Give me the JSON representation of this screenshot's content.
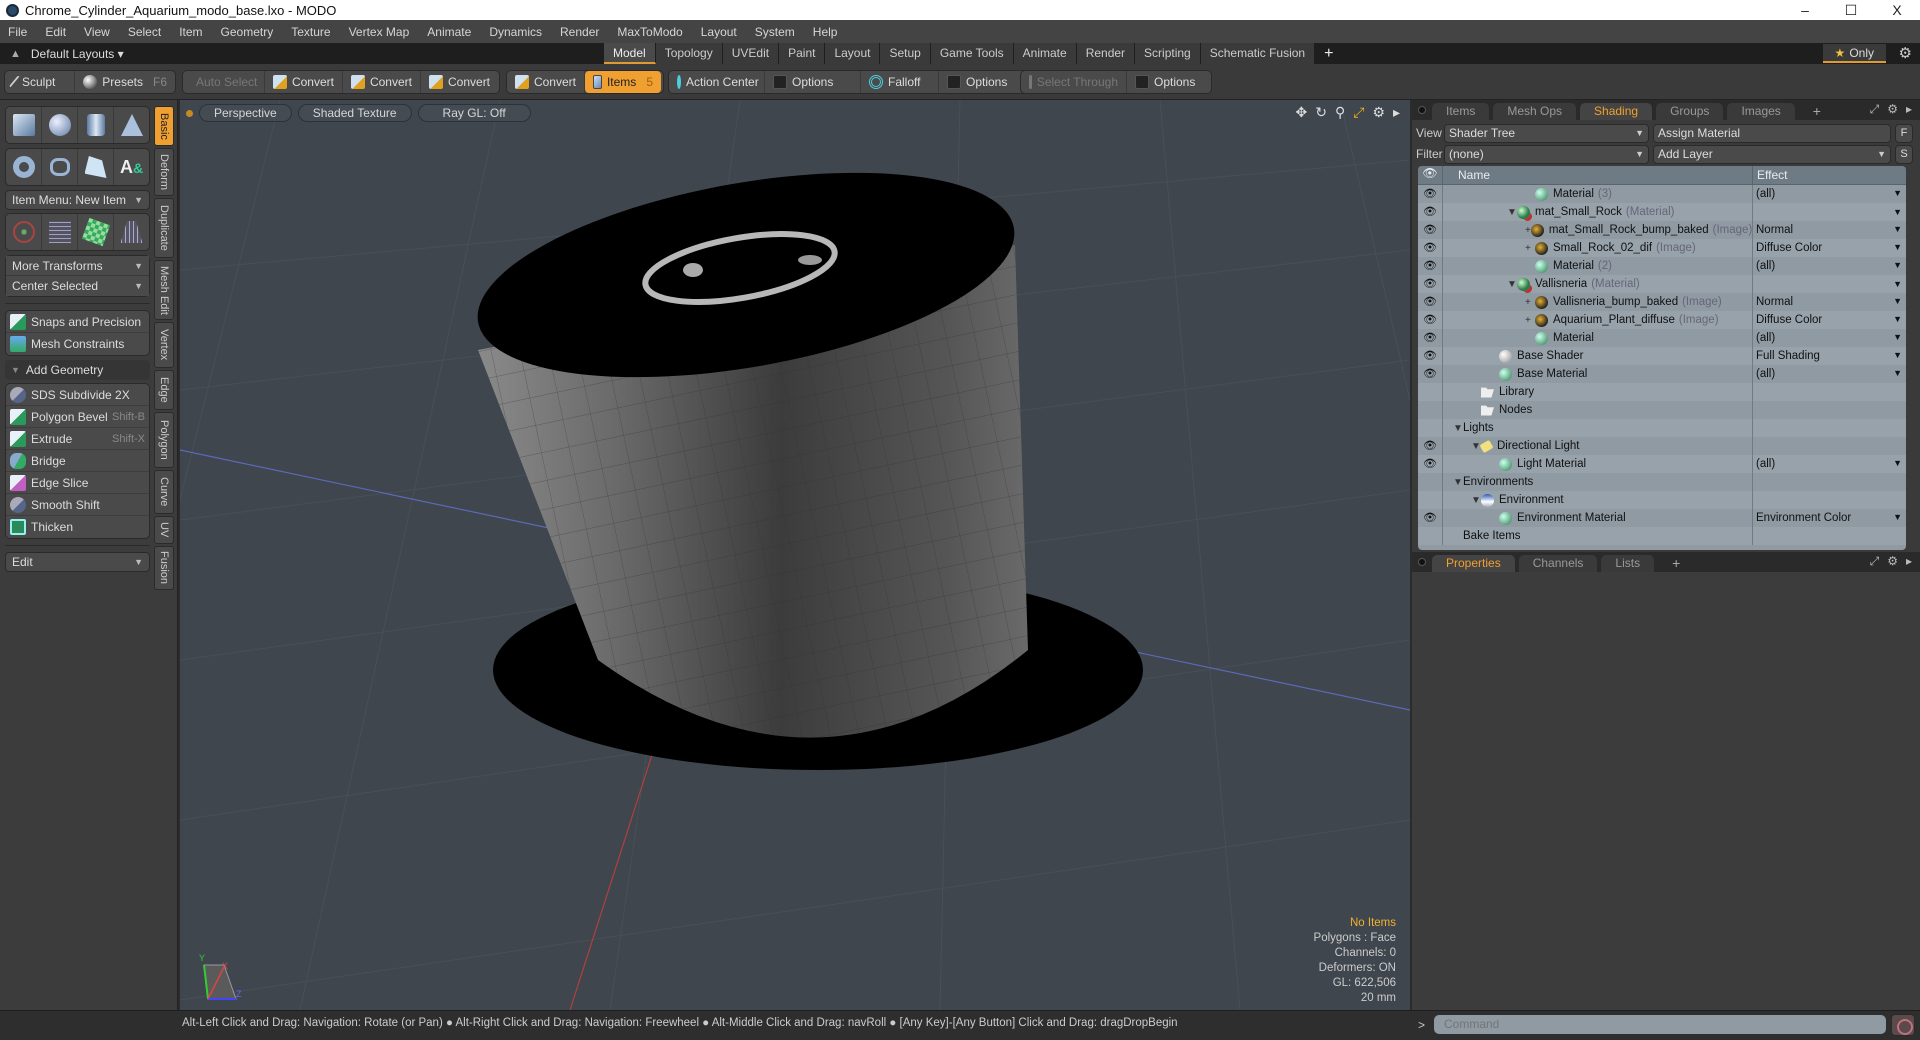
{
  "window": {
    "title": "Chrome_Cylinder_Aquarium_modo_base.lxo - MODO",
    "controls": [
      "–",
      "☐",
      "X"
    ]
  },
  "menu": [
    "File",
    "Edit",
    "View",
    "Select",
    "Item",
    "Geometry",
    "Texture",
    "Vertex Map",
    "Animate",
    "Dynamics",
    "Render",
    "MaxToModo",
    "Layout",
    "System",
    "Help"
  ],
  "layoutbar": {
    "layouts_label": "Default Layouts ▾",
    "mode_tabs": [
      "Model",
      "Topology",
      "UVEdit",
      "Paint",
      "Layout",
      "Setup",
      "Game Tools",
      "Animate",
      "Render",
      "Scripting",
      "Schematic Fusion"
    ],
    "active_tab": "Model",
    "only_label": "Only"
  },
  "toolbar": {
    "sculpt": "Sculpt",
    "presets": "Presets",
    "presets_shortcut": "F6",
    "auto_select": "Auto Select",
    "convert1": "Convert",
    "convert2": "Convert",
    "convert3": "Convert",
    "convert4": "Convert",
    "items": "Items",
    "items_count": "5",
    "action_center": "Action Center",
    "options1": "Options",
    "falloff": "Falloff",
    "options2": "Options",
    "select_through": "Select Through",
    "options3": "Options"
  },
  "leftpanel": {
    "item_menu": "Item Menu: New Item",
    "more_transforms": "More Transforms",
    "center_selected": "Center Selected",
    "snaps": "Snaps and Precision",
    "mesh_constraints": "Mesh Constraints",
    "add_geometry": "Add Geometry",
    "tools": [
      {
        "label": "SDS Subdivide 2X",
        "shortcut": ""
      },
      {
        "label": "Polygon Bevel",
        "shortcut": "Shift-B"
      },
      {
        "label": "Extrude",
        "shortcut": "Shift-X"
      },
      {
        "label": "Bridge",
        "shortcut": ""
      },
      {
        "label": "Edge Slice",
        "shortcut": ""
      },
      {
        "label": "Smooth Shift",
        "shortcut": ""
      },
      {
        "label": "Thicken",
        "shortcut": ""
      }
    ],
    "edit_dropdown": "Edit",
    "vtabs": [
      "Basic",
      "Deform",
      "Duplicate",
      "Mesh Edit",
      "Vertex",
      "Edge",
      "Polygon",
      "Curve",
      "UV",
      "Fusion"
    ],
    "active_vtab": "Basic"
  },
  "viewport": {
    "view": "Perspective",
    "shading": "Shaded Texture",
    "raygl": "Ray GL: Off",
    "info": {
      "items": "No Items",
      "polygons": "Polygons : Face",
      "channels": "Channels: 0",
      "deformers": "Deformers: ON",
      "gl": "GL: 622,506",
      "units": "20 mm"
    },
    "axis_labels": {
      "x": "X",
      "y": "Y",
      "z": "Z"
    }
  },
  "rightpanel": {
    "tabs": [
      "Items",
      "Mesh Ops",
      "Shading",
      "Groups",
      "Images"
    ],
    "active_tab": "Shading",
    "view_label": "View",
    "view_value": "Shader Tree",
    "assign_material": "Assign Material",
    "f_btn": "F",
    "filter_label": "Filter",
    "filter_value": "(none)",
    "add_layer": "Add Layer",
    "s_btn": "S",
    "columns": {
      "name": "Name",
      "effect": "Effect"
    },
    "rows": [
      {
        "eye": true,
        "indent": 4,
        "icon": "mat",
        "name": "Material",
        "type": "(3)",
        "effect": "(all)",
        "exp": ""
      },
      {
        "eye": true,
        "indent": 3,
        "icon": "grp",
        "name": "mat_Small_Rock",
        "type": "(Material)",
        "effect": "",
        "exp": "▼"
      },
      {
        "eye": true,
        "indent": 4,
        "icon": "img",
        "name": "mat_Small_Rock_bump_baked",
        "type": "(Image)",
        "effect": "Normal",
        "exp": "+"
      },
      {
        "eye": true,
        "indent": 4,
        "icon": "img",
        "name": "Small_Rock_02_dif",
        "type": "(Image)",
        "effect": "Diffuse Color",
        "exp": "+"
      },
      {
        "eye": true,
        "indent": 4,
        "icon": "mat",
        "name": "Material",
        "type": "(2)",
        "effect": "(all)",
        "exp": ""
      },
      {
        "eye": true,
        "indent": 3,
        "icon": "grp",
        "name": "Vallisneria",
        "type": "(Material)",
        "effect": "",
        "exp": "▼"
      },
      {
        "eye": true,
        "indent": 4,
        "icon": "img",
        "name": "Vallisneria_bump_baked",
        "type": "(Image)",
        "effect": "Normal",
        "exp": "+"
      },
      {
        "eye": true,
        "indent": 4,
        "icon": "img",
        "name": "Aquarium_Plant_diffuse",
        "type": "(Image)",
        "effect": "Diffuse Color",
        "exp": "+"
      },
      {
        "eye": true,
        "indent": 4,
        "icon": "mat",
        "name": "Material",
        "type": "",
        "effect": "(all)",
        "exp": ""
      },
      {
        "eye": true,
        "indent": 2,
        "icon": "base",
        "name": "Base Shader",
        "type": "",
        "effect": "Full Shading",
        "exp": ""
      },
      {
        "eye": true,
        "indent": 2,
        "icon": "mat",
        "name": "Base Material",
        "type": "",
        "effect": "(all)",
        "exp": ""
      },
      {
        "eye": false,
        "indent": 1,
        "icon": "folder",
        "name": "Library",
        "type": "",
        "effect": "",
        "exp": ""
      },
      {
        "eye": false,
        "indent": 1,
        "icon": "folder",
        "name": "Nodes",
        "type": "",
        "effect": "",
        "exp": ""
      },
      {
        "eye": false,
        "indent": 0,
        "icon": "",
        "name": "Lights",
        "type": "",
        "effect": "",
        "exp": "▼"
      },
      {
        "eye": true,
        "indent": 1,
        "icon": "light",
        "name": "Directional Light",
        "type": "",
        "effect": "",
        "exp": "▼"
      },
      {
        "eye": true,
        "indent": 2,
        "icon": "mat",
        "name": "Light Material",
        "type": "",
        "effect": "(all)",
        "exp": ""
      },
      {
        "eye": false,
        "indent": 0,
        "icon": "",
        "name": "Environments",
        "type": "",
        "effect": "",
        "exp": "▼"
      },
      {
        "eye": false,
        "indent": 1,
        "icon": "env",
        "name": "Environment",
        "type": "",
        "effect": "",
        "exp": "▼"
      },
      {
        "eye": true,
        "indent": 2,
        "icon": "mat",
        "name": "Environment Material",
        "type": "",
        "effect": "Environment Color",
        "exp": ""
      },
      {
        "eye": false,
        "indent": 0,
        "icon": "",
        "name": "Bake Items",
        "type": "",
        "effect": "",
        "exp": ""
      }
    ],
    "bottom_tabs": [
      "Properties",
      "Channels",
      "Lists"
    ],
    "bottom_active": "Properties"
  },
  "statusbar": {
    "message": "Alt-Left Click and Drag: Navigation: Rotate (or Pan) ● Alt-Right Click and Drag: Navigation: Freewheel ● Alt-Middle Click and Drag: navRoll ● [Any Key]-[Any Button] Click and Drag: dragDropBegin",
    "prompt": ">",
    "command_placeholder": "Command"
  }
}
